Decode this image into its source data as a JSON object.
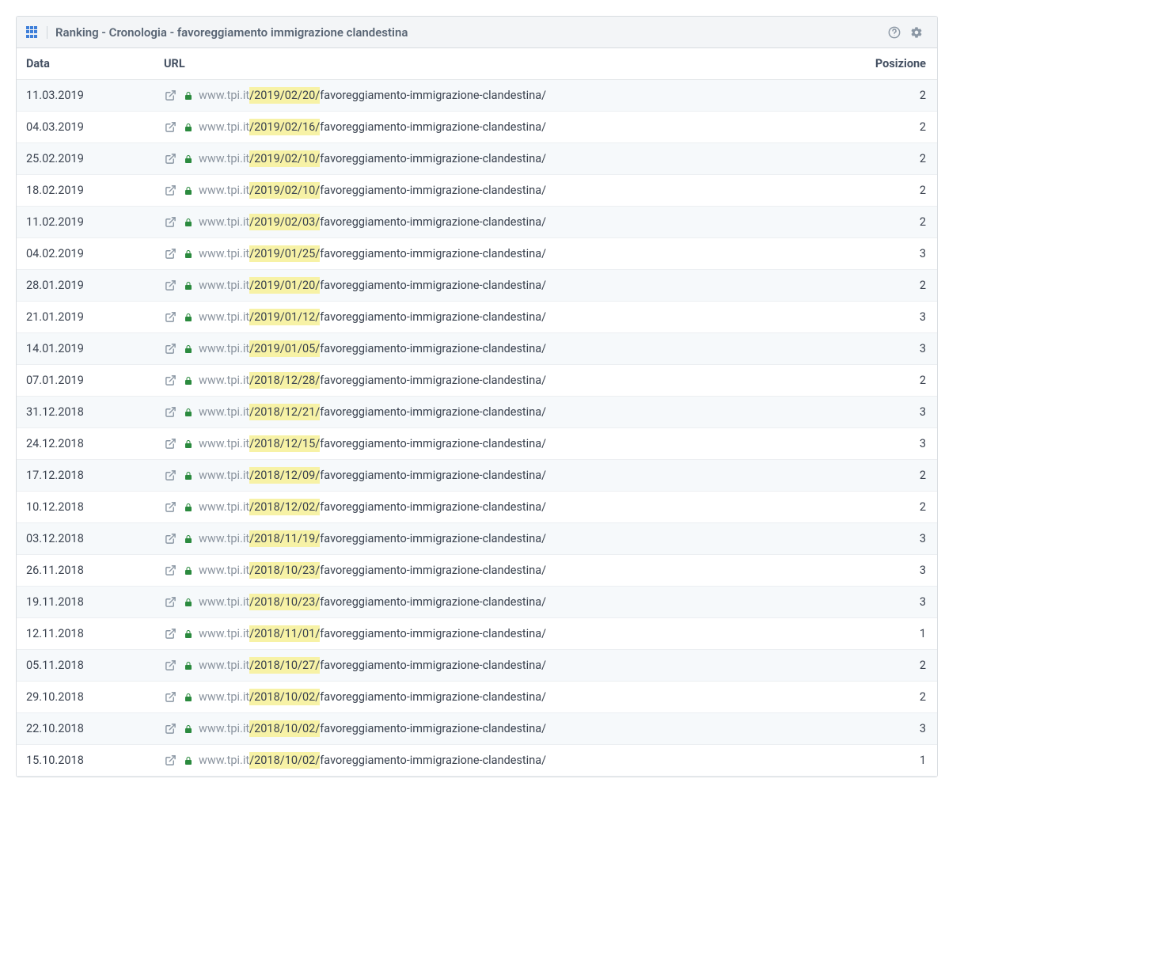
{
  "header": {
    "title": "Ranking - Cronologia - favoreggiamento immigrazione clandestina"
  },
  "columns": {
    "date": "Data",
    "url": "URL",
    "position": "Posizione"
  },
  "url_root": "www.tpi.it",
  "url_slug": "favoreggiamento-immigrazione-clandestina/",
  "rows": [
    {
      "date": "11.03.2019",
      "url_date": "/2019/02/20/",
      "position": 2
    },
    {
      "date": "04.03.2019",
      "url_date": "/2019/02/16/",
      "position": 2
    },
    {
      "date": "25.02.2019",
      "url_date": "/2019/02/10/",
      "position": 2
    },
    {
      "date": "18.02.2019",
      "url_date": "/2019/02/10/",
      "position": 2
    },
    {
      "date": "11.02.2019",
      "url_date": "/2019/02/03/",
      "position": 2
    },
    {
      "date": "04.02.2019",
      "url_date": "/2019/01/25/",
      "position": 3
    },
    {
      "date": "28.01.2019",
      "url_date": "/2019/01/20/",
      "position": 2
    },
    {
      "date": "21.01.2019",
      "url_date": "/2019/01/12/",
      "position": 3
    },
    {
      "date": "14.01.2019",
      "url_date": "/2019/01/05/",
      "position": 3
    },
    {
      "date": "07.01.2019",
      "url_date": "/2018/12/28/",
      "position": 2
    },
    {
      "date": "31.12.2018",
      "url_date": "/2018/12/21/",
      "position": 3
    },
    {
      "date": "24.12.2018",
      "url_date": "/2018/12/15/",
      "position": 3
    },
    {
      "date": "17.12.2018",
      "url_date": "/2018/12/09/",
      "position": 2
    },
    {
      "date": "10.12.2018",
      "url_date": "/2018/12/02/",
      "position": 2
    },
    {
      "date": "03.12.2018",
      "url_date": "/2018/11/19/",
      "position": 3
    },
    {
      "date": "26.11.2018",
      "url_date": "/2018/10/23/",
      "position": 3
    },
    {
      "date": "19.11.2018",
      "url_date": "/2018/10/23/",
      "position": 3
    },
    {
      "date": "12.11.2018",
      "url_date": "/2018/11/01/",
      "position": 1
    },
    {
      "date": "05.11.2018",
      "url_date": "/2018/10/27/",
      "position": 2
    },
    {
      "date": "29.10.2018",
      "url_date": "/2018/10/02/",
      "position": 2
    },
    {
      "date": "22.10.2018",
      "url_date": "/2018/10/02/",
      "position": 3
    },
    {
      "date": "15.10.2018",
      "url_date": "/2018/10/02/",
      "position": 1
    }
  ]
}
